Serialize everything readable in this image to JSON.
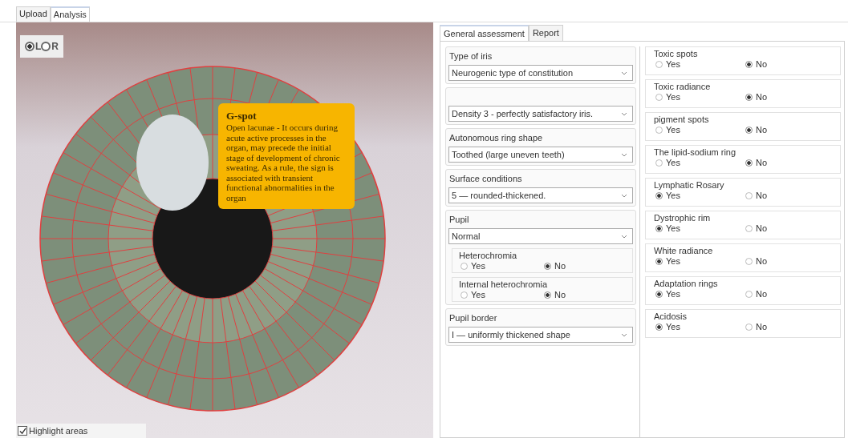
{
  "top_tabs": [
    {
      "label": "Upload",
      "selected": false
    },
    {
      "label": "Analysis",
      "selected": true
    }
  ],
  "eye_view": {
    "side_options": [
      {
        "label": "L",
        "selected": true
      },
      {
        "label": "R",
        "selected": false
      }
    ],
    "tooltip": {
      "title": "G-spot",
      "text": "Open lacunae - It occurs during acute active processes in the organ, may precede the initial stage of development of chronic sweating. As a rule, the sign is associated with transient functional abnormalities in the organ"
    },
    "highlight_areas": {
      "label": "Highlight areas",
      "checked": true
    }
  },
  "assessment_tabs": [
    {
      "label": "General assessment",
      "selected": true
    },
    {
      "label": "Report",
      "selected": false
    }
  ],
  "left_groups": [
    {
      "label": "Type of iris",
      "value": "Neurogenic type of constitution"
    },
    {
      "value": "Density 3 - perfectly satisfactory iris."
    },
    {
      "label": "Autonomous ring shape",
      "value": "Toothed (large uneven teeth)"
    },
    {
      "label": "Surface conditions",
      "value": "5 — rounded-thickened."
    },
    {
      "label": "Pupil",
      "value": "Normal",
      "sub_groups": [
        {
          "label": "Heterochromia",
          "options": [
            {
              "label": "Yes",
              "selected": false
            },
            {
              "label": "No",
              "selected": true
            }
          ]
        },
        {
          "label": "Internal heterochromia",
          "options": [
            {
              "label": "Yes",
              "selected": false
            },
            {
              "label": "No",
              "selected": true
            }
          ]
        }
      ]
    },
    {
      "label": "Pupil border",
      "value": "I — uniformly thickened shape"
    }
  ],
  "right_groups": [
    {
      "label": "Toxic spots",
      "options": [
        {
          "label": "Yes",
          "selected": false
        },
        {
          "label": "No",
          "selected": true
        }
      ]
    },
    {
      "label": "Toxic radiance",
      "options": [
        {
          "label": "Yes",
          "selected": false
        },
        {
          "label": "No",
          "selected": true
        }
      ]
    },
    {
      "label": "pigment spots",
      "options": [
        {
          "label": "Yes",
          "selected": false
        },
        {
          "label": "No",
          "selected": true
        }
      ]
    },
    {
      "label": "The lipid-sodium ring",
      "options": [
        {
          "label": "Yes",
          "selected": false
        },
        {
          "label": "No",
          "selected": true
        }
      ]
    },
    {
      "label": "Lymphatic Rosary",
      "options": [
        {
          "label": "Yes",
          "selected": true
        },
        {
          "label": "No",
          "selected": false
        }
      ]
    },
    {
      "label": "Dystrophic rim",
      "options": [
        {
          "label": "Yes",
          "selected": true
        },
        {
          "label": "No",
          "selected": false
        }
      ]
    },
    {
      "label": "White radiance",
      "options": [
        {
          "label": "Yes",
          "selected": true
        },
        {
          "label": "No",
          "selected": false
        }
      ]
    },
    {
      "label": "Adaptation rings",
      "options": [
        {
          "label": "Yes",
          "selected": true
        },
        {
          "label": "No",
          "selected": false
        }
      ]
    },
    {
      "label": "Acidosis",
      "options": [
        {
          "label": "Yes",
          "selected": true
        },
        {
          "label": "No",
          "selected": false
        }
      ]
    }
  ]
}
